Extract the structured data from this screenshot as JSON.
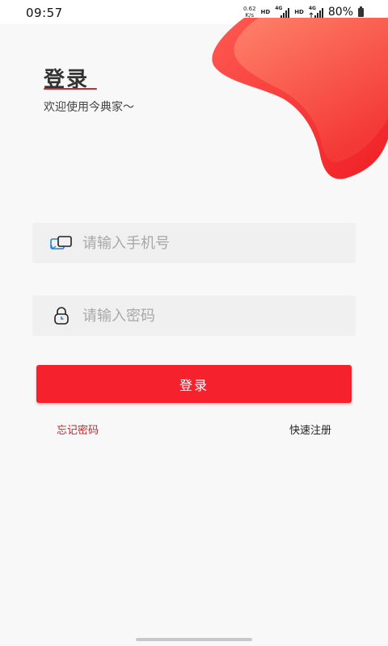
{
  "status_bar": {
    "time": "09:57",
    "net_speed_value": "0.62",
    "net_speed_unit": "K/s",
    "hd_label_1": "HD",
    "hd_label_2": "HD",
    "network_1": "4G",
    "network_2": "4G",
    "battery": "80%"
  },
  "header": {
    "title": "登录",
    "subtitle": "欢迎使用今典家～"
  },
  "form": {
    "phone_placeholder": "请输入手机号",
    "password_placeholder": "请输入密码",
    "login_label": "登录"
  },
  "links": {
    "forgot_password": "忘记密码",
    "quick_register": "快速注册"
  },
  "colors": {
    "accent": "#f5222d",
    "title_underline": "#d8262c",
    "forgot_link": "#c0262c",
    "background": "#f8f8f8",
    "input_bg": "#f0f0f0"
  },
  "icons": {
    "phone_field": "account-bubbles-icon",
    "password_field": "lock-clock-icon"
  }
}
